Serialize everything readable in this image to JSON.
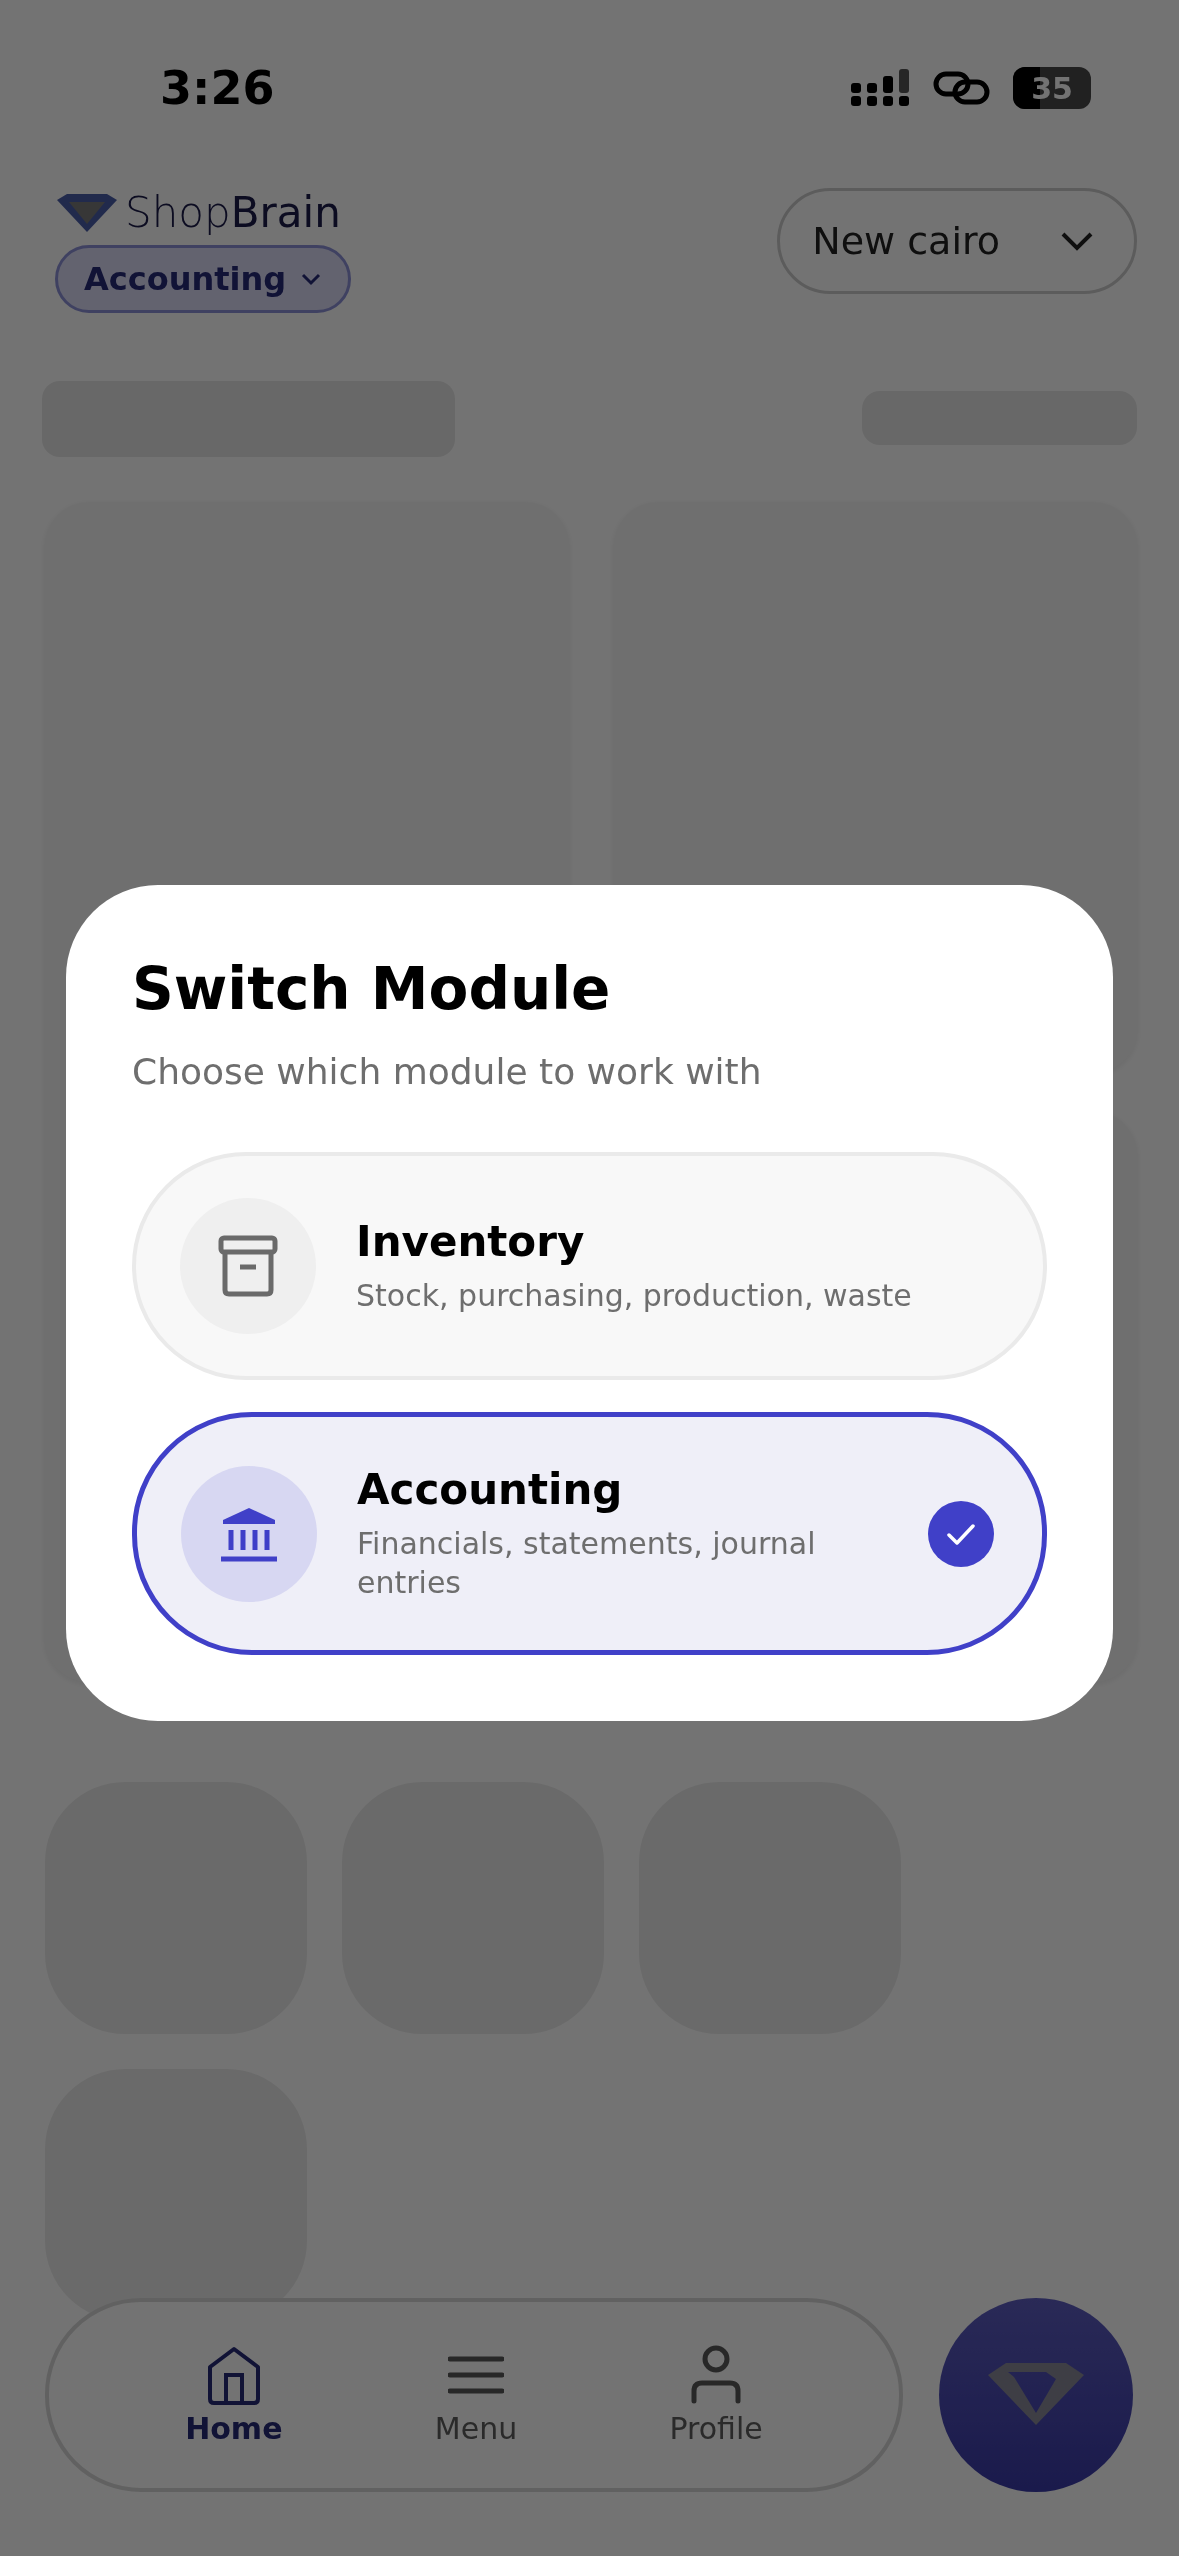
{
  "status_bar": {
    "time": "3:26",
    "battery": "35"
  },
  "header": {
    "logo": "Shop**Brain**",
    "module_chip": {
      "label": "Accounting"
    },
    "branch_select": {
      "value": "New cairo"
    }
  },
  "modal": {
    "title": "Switch Module",
    "subtitle": "Choose which module to work with",
    "options": [
      {
        "label": "Inventory",
        "description": "Stock, purchasing, production, waste",
        "selected": false
      },
      {
        "label": "Accounting",
        "description": "Financials, statements, journal entries",
        "selected": true
      }
    ]
  },
  "bottom_nav": {
    "items": [
      {
        "label": "Home",
        "selected": true
      },
      {
        "label": "Menu",
        "selected": false
      },
      {
        "label": "Profile",
        "selected": false
      }
    ]
  }
}
